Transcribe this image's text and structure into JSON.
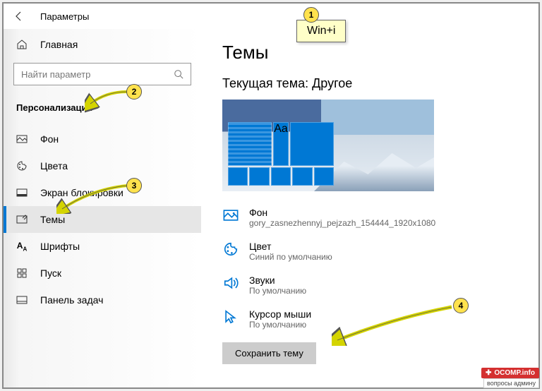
{
  "titlebar": {
    "title": "Параметры"
  },
  "sidebar": {
    "home_label": "Главная",
    "search_placeholder": "Найти параметр",
    "section_label": "Персонализация",
    "items": [
      {
        "label": "Фон"
      },
      {
        "label": "Цвета"
      },
      {
        "label": "Экран блокировки"
      },
      {
        "label": "Темы"
      },
      {
        "label": "Шрифты"
      },
      {
        "label": "Пуск"
      },
      {
        "label": "Панель задач"
      }
    ]
  },
  "main": {
    "heading": "Темы",
    "current_theme_label": "Текущая тема: Другое",
    "preview_sample_text": "Aa",
    "settings": [
      {
        "title": "Фон",
        "value": "gory_zasnezhennyj_pejzazh_154444_1920x1080"
      },
      {
        "title": "Цвет",
        "value": "Синий по умолчанию"
      },
      {
        "title": "Звуки",
        "value": "По умолчанию"
      },
      {
        "title": "Курсор мыши",
        "value": "По умолчанию"
      }
    ],
    "save_button": "Сохранить тему"
  },
  "annotations": {
    "callout1": "1",
    "callout1_text": "Win+i",
    "callout2": "2",
    "callout3": "3",
    "callout4": "4"
  },
  "watermark": {
    "brand": "OCOMP.info",
    "tagline": "вопросы админу"
  }
}
